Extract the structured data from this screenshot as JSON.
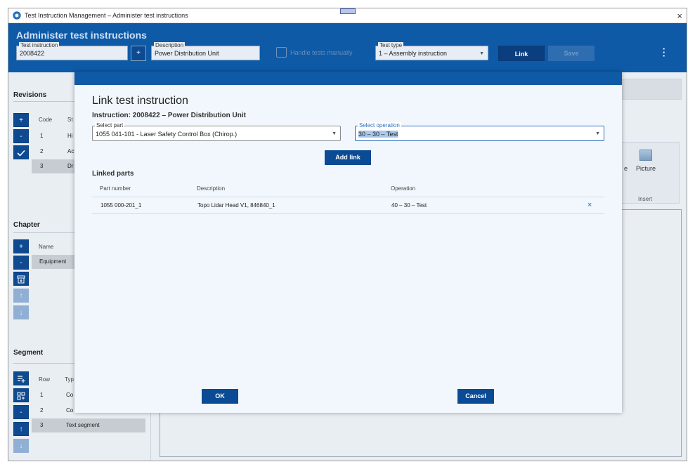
{
  "window": {
    "title": "Test Instruction Management – Administer test instructions",
    "close": "×"
  },
  "header": {
    "title": "Administer test instructions",
    "test_instruction": {
      "label": "Test instruction",
      "value": "2008422"
    },
    "plus": "+",
    "description": {
      "label": "Description",
      "value": "Power Distribution Unit"
    },
    "handle_manually": "Handle tests manually",
    "test_type": {
      "label": "Test type",
      "value": "1 – Assembly instruction"
    },
    "link": "Link",
    "save": "Save",
    "kebab": "⋮"
  },
  "revisions": {
    "title": "Revisions",
    "col_code": "Code",
    "col_status": "St",
    "rows": [
      {
        "code": "1",
        "status": "Hi"
      },
      {
        "code": "2",
        "status": "Ac"
      },
      {
        "code": "3",
        "status": "Dr"
      }
    ]
  },
  "chapter": {
    "title": "Chapter",
    "col_name": "Name",
    "rows": [
      "Equipment"
    ]
  },
  "segment": {
    "title": "Segment",
    "col_row": "Row",
    "col_type": "Typ",
    "rows": [
      {
        "row": "1",
        "type": "Co"
      },
      {
        "row": "2",
        "type": "Co"
      },
      {
        "row": "3",
        "type": "Text segment"
      }
    ]
  },
  "ribbon": {
    "picture": "Picture",
    "insert": "Insert",
    "partial": "e"
  },
  "modal": {
    "title": "Link test instruction",
    "subtitle": "Instruction: 2008422 – Power Distribution Unit",
    "select_part": {
      "label": "Select part",
      "value": "1055 041-101 - Laser Safety Control Box (Chirop.)"
    },
    "select_operation": {
      "label": "Select operation",
      "value": "30 – 30 – Test"
    },
    "add_link": "Add link",
    "linked_parts": "Linked parts",
    "columns": {
      "part": "Part number",
      "desc": "Description",
      "op": "Operation"
    },
    "rows": [
      {
        "part": "1055 000-201_1",
        "desc": "Topo Lidar Head V1, 846840_1",
        "op": "40 – 30 – Test"
      }
    ],
    "ok": "OK",
    "cancel": "Cancel"
  },
  "icons": {
    "plus": "+",
    "minus": "-",
    "check": "✓",
    "up": "↑",
    "down": "↓",
    "remove": "×"
  }
}
